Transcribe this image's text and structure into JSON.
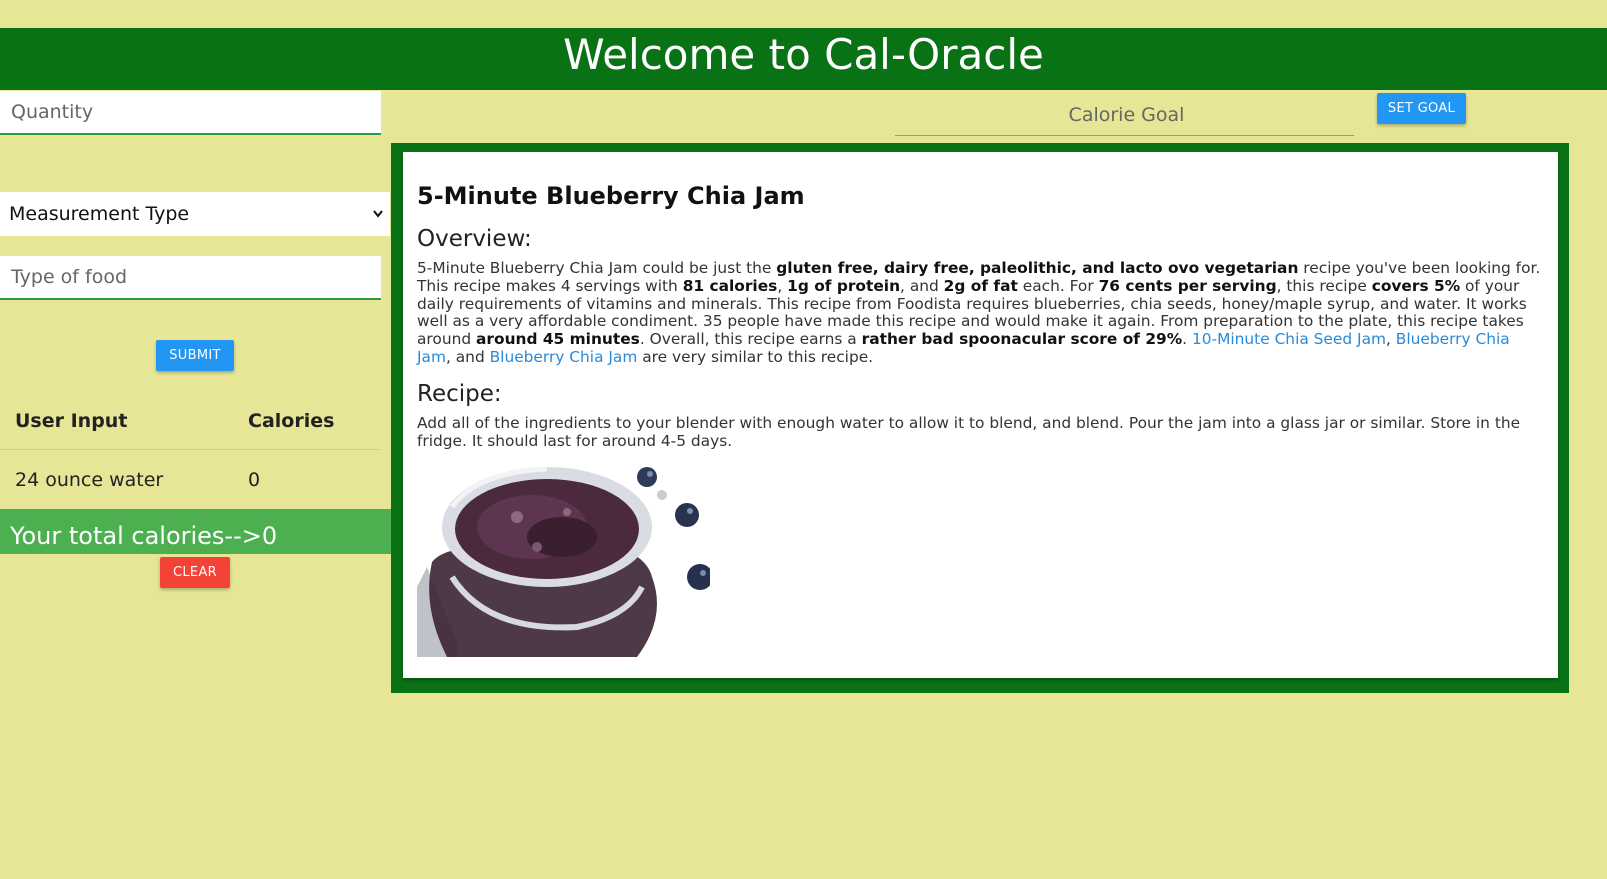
{
  "header": {
    "title": "Welcome to Cal-Oracle"
  },
  "form": {
    "quantity_placeholder": "Quantity",
    "measurement_selected": "Measurement Type",
    "food_placeholder": "Type of food",
    "submit_label": "SUBMIT"
  },
  "table": {
    "headers": [
      "User Input",
      "Calories"
    ],
    "rows": [
      {
        "input": "24 ounce water",
        "calories": "0"
      }
    ]
  },
  "total": {
    "text": "Your total calories-->0"
  },
  "clear_label": "CLEAR",
  "goal": {
    "placeholder": "Calorie Goal",
    "button_label": "SET GOAL"
  },
  "recipe": {
    "title": "5-Minute Blueberry Chia Jam",
    "overview_heading": "Overview:",
    "overview_parts": {
      "t1": "5-Minute Blueberry Chia Jam could be just the ",
      "b1": "gluten free, dairy free, paleolithic, and lacto ovo vegetarian",
      "t2": " recipe you've been looking for. This recipe makes 4 servings with ",
      "b2": "81 calories",
      "t3": ", ",
      "b3": "1g of protein",
      "t4": ", and ",
      "b4": "2g of fat",
      "t5": " each. For ",
      "b5": "76 cents per serving",
      "t6": ", this recipe ",
      "b6": "covers 5%",
      "t7": " of your daily requirements of vitamins and minerals. This recipe from Foodista requires blueberries, chia seeds, honey/maple syrup, and water. It works well as a very affordable condiment. 35 people have made this recipe and would make it again. From preparation to the plate, this recipe takes around ",
      "b7": "around 45 minutes",
      "t8": ". Overall, this recipe earns a ",
      "b8": "rather bad spoonacular score of 29%",
      "t9": ". ",
      "l1": "10-Minute Chia Seed Jam",
      "t10": ", ",
      "l2": "Blueberry Chia Jam",
      "t11": ", and ",
      "l3": "Blueberry Chia Jam",
      "t12": " are very similar to this recipe."
    },
    "recipe_heading": "Recipe:",
    "instructions": "Add all of the ingredients to your blender with enough water to allow it to blend, and blend. Pour the jam into a glass jar or similar. Store in the fridge. It should last for around 4-5 days."
  },
  "colors": {
    "background": "#e6e696",
    "header": "#087214",
    "total_bar": "#4caf50",
    "primary_button": "#2196f3",
    "danger_button": "#f44336",
    "link": "#2a8ad8"
  }
}
